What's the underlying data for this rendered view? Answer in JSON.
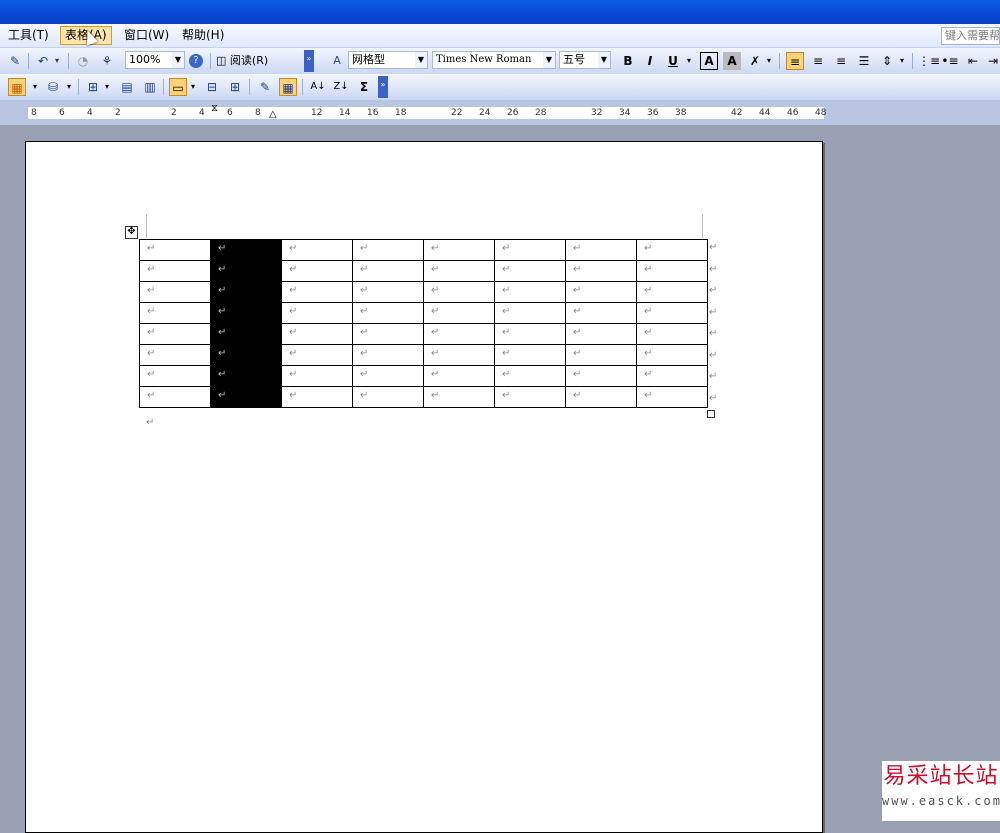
{
  "menu": {
    "items": [
      {
        "label": "工具(T)"
      },
      {
        "label": "表格(A)"
      },
      {
        "label": "窗口(W)"
      },
      {
        "label": "帮助(H)"
      }
    ],
    "help_box": "键入需要帮"
  },
  "toolbar1": {
    "zoom": "100%",
    "read_label": "阅读(R)",
    "style": "网格型",
    "font": "Times New Roman",
    "size": "五号",
    "bold": "B",
    "italic": "I",
    "underline": "U",
    "char_border": "A",
    "char_shade": "A"
  },
  "toolbar2": {
    "sum": "Σ"
  },
  "ruler": {
    "numbers": [
      "8",
      "6",
      "4",
      "2",
      "2",
      "4",
      "6",
      "8",
      "12",
      "14",
      "16",
      "18",
      "22",
      "24",
      "26",
      "28",
      "32",
      "34",
      "36",
      "38",
      "42",
      "44",
      "46",
      "48"
    ]
  },
  "document": {
    "cell_mark": "↵",
    "rows": 8,
    "cols": 8,
    "selected_column": 2
  },
  "watermark": {
    "name": "易采站长站",
    "url": "www.easck.com"
  }
}
